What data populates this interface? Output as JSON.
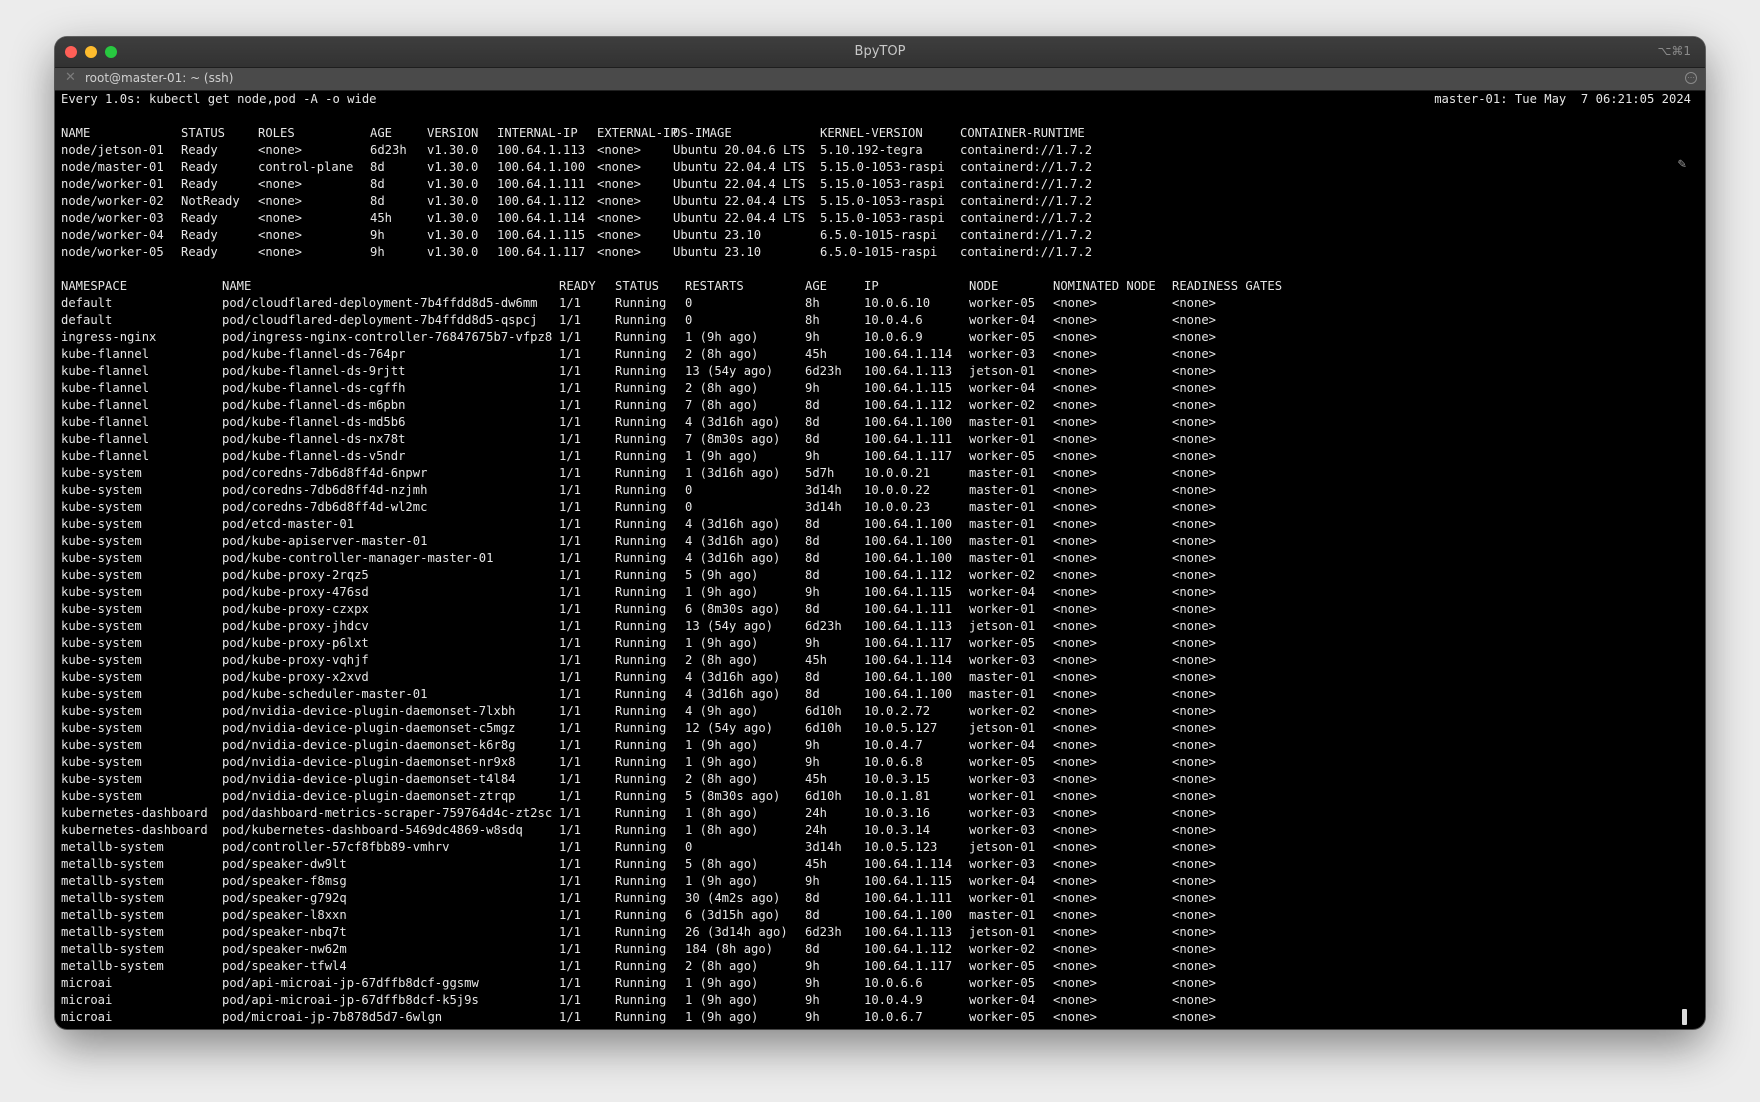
{
  "window": {
    "title": "BpyTOP",
    "shortcut": "⌥⌘1",
    "tab_title": "root@master-01: ~ (ssh)",
    "tab_close_glyph": "✕",
    "tab_menu_glyph": "⋯"
  },
  "watch": {
    "header": "Every 1.0s: kubectl get node,pod -A -o wide",
    "host_time": "master-01: Tue May  7 06:21:05 2024"
  },
  "nodes": {
    "columns": [
      "NAME",
      "STATUS",
      "ROLES",
      "AGE",
      "VERSION",
      "INTERNAL-IP",
      "EXTERNAL-IP",
      "OS-IMAGE",
      "KERNEL-VERSION",
      "CONTAINER-RUNTIME"
    ],
    "rows": [
      [
        "node/jetson-01",
        "Ready",
        "<none>",
        "6d23h",
        "v1.30.0",
        "100.64.1.113",
        "<none>",
        "Ubuntu 20.04.6 LTS",
        "5.10.192-tegra",
        "containerd://1.7.2"
      ],
      [
        "node/master-01",
        "Ready",
        "control-plane",
        "8d",
        "v1.30.0",
        "100.64.1.100",
        "<none>",
        "Ubuntu 22.04.4 LTS",
        "5.15.0-1053-raspi",
        "containerd://1.7.2"
      ],
      [
        "node/worker-01",
        "Ready",
        "<none>",
        "8d",
        "v1.30.0",
        "100.64.1.111",
        "<none>",
        "Ubuntu 22.04.4 LTS",
        "5.15.0-1053-raspi",
        "containerd://1.7.2"
      ],
      [
        "node/worker-02",
        "NotReady",
        "<none>",
        "8d",
        "v1.30.0",
        "100.64.1.112",
        "<none>",
        "Ubuntu 22.04.4 LTS",
        "5.15.0-1053-raspi",
        "containerd://1.7.2"
      ],
      [
        "node/worker-03",
        "Ready",
        "<none>",
        "45h",
        "v1.30.0",
        "100.64.1.114",
        "<none>",
        "Ubuntu 22.04.4 LTS",
        "5.15.0-1053-raspi",
        "containerd://1.7.2"
      ],
      [
        "node/worker-04",
        "Ready",
        "<none>",
        "9h",
        "v1.30.0",
        "100.64.1.115",
        "<none>",
        "Ubuntu 23.10",
        "6.5.0-1015-raspi",
        "containerd://1.7.2"
      ],
      [
        "node/worker-05",
        "Ready",
        "<none>",
        "9h",
        "v1.30.0",
        "100.64.1.117",
        "<none>",
        "Ubuntu 23.10",
        "6.5.0-1015-raspi",
        "containerd://1.7.2"
      ]
    ]
  },
  "pods": {
    "columns": [
      "NAMESPACE",
      "NAME",
      "READY",
      "STATUS",
      "RESTARTS",
      "AGE",
      "IP",
      "NODE",
      "NOMINATED NODE",
      "READINESS GATES"
    ],
    "rows": [
      [
        "default",
        "pod/cloudflared-deployment-7b4ffdd8d5-dw6mm",
        "1/1",
        "Running",
        "0",
        "8h",
        "10.0.6.10",
        "worker-05",
        "<none>",
        "<none>"
      ],
      [
        "default",
        "pod/cloudflared-deployment-7b4ffdd8d5-qspcj",
        "1/1",
        "Running",
        "0",
        "8h",
        "10.0.4.6",
        "worker-04",
        "<none>",
        "<none>"
      ],
      [
        "ingress-nginx",
        "pod/ingress-nginx-controller-76847675b7-vfpz8",
        "1/1",
        "Running",
        "1 (9h ago)",
        "9h",
        "10.0.6.9",
        "worker-05",
        "<none>",
        "<none>"
      ],
      [
        "kube-flannel",
        "pod/kube-flannel-ds-764pr",
        "1/1",
        "Running",
        "2 (8h ago)",
        "45h",
        "100.64.1.114",
        "worker-03",
        "<none>",
        "<none>"
      ],
      [
        "kube-flannel",
        "pod/kube-flannel-ds-9rjtt",
        "1/1",
        "Running",
        "13 (54y ago)",
        "6d23h",
        "100.64.1.113",
        "jetson-01",
        "<none>",
        "<none>"
      ],
      [
        "kube-flannel",
        "pod/kube-flannel-ds-cgffh",
        "1/1",
        "Running",
        "2 (8h ago)",
        "9h",
        "100.64.1.115",
        "worker-04",
        "<none>",
        "<none>"
      ],
      [
        "kube-flannel",
        "pod/kube-flannel-ds-m6pbn",
        "1/1",
        "Running",
        "7 (8h ago)",
        "8d",
        "100.64.1.112",
        "worker-02",
        "<none>",
        "<none>"
      ],
      [
        "kube-flannel",
        "pod/kube-flannel-ds-md5b6",
        "1/1",
        "Running",
        "4 (3d16h ago)",
        "8d",
        "100.64.1.100",
        "master-01",
        "<none>",
        "<none>"
      ],
      [
        "kube-flannel",
        "pod/kube-flannel-ds-nx78t",
        "1/1",
        "Running",
        "7 (8m30s ago)",
        "8d",
        "100.64.1.111",
        "worker-01",
        "<none>",
        "<none>"
      ],
      [
        "kube-flannel",
        "pod/kube-flannel-ds-v5ndr",
        "1/1",
        "Running",
        "1 (9h ago)",
        "9h",
        "100.64.1.117",
        "worker-05",
        "<none>",
        "<none>"
      ],
      [
        "kube-system",
        "pod/coredns-7db6d8ff4d-6npwr",
        "1/1",
        "Running",
        "1 (3d16h ago)",
        "5d7h",
        "10.0.0.21",
        "master-01",
        "<none>",
        "<none>"
      ],
      [
        "kube-system",
        "pod/coredns-7db6d8ff4d-nzjmh",
        "1/1",
        "Running",
        "0",
        "3d14h",
        "10.0.0.22",
        "master-01",
        "<none>",
        "<none>"
      ],
      [
        "kube-system",
        "pod/coredns-7db6d8ff4d-wl2mc",
        "1/1",
        "Running",
        "0",
        "3d14h",
        "10.0.0.23",
        "master-01",
        "<none>",
        "<none>"
      ],
      [
        "kube-system",
        "pod/etcd-master-01",
        "1/1",
        "Running",
        "4 (3d16h ago)",
        "8d",
        "100.64.1.100",
        "master-01",
        "<none>",
        "<none>"
      ],
      [
        "kube-system",
        "pod/kube-apiserver-master-01",
        "1/1",
        "Running",
        "4 (3d16h ago)",
        "8d",
        "100.64.1.100",
        "master-01",
        "<none>",
        "<none>"
      ],
      [
        "kube-system",
        "pod/kube-controller-manager-master-01",
        "1/1",
        "Running",
        "4 (3d16h ago)",
        "8d",
        "100.64.1.100",
        "master-01",
        "<none>",
        "<none>"
      ],
      [
        "kube-system",
        "pod/kube-proxy-2rqz5",
        "1/1",
        "Running",
        "5 (9h ago)",
        "8d",
        "100.64.1.112",
        "worker-02",
        "<none>",
        "<none>"
      ],
      [
        "kube-system",
        "pod/kube-proxy-476sd",
        "1/1",
        "Running",
        "1 (9h ago)",
        "9h",
        "100.64.1.115",
        "worker-04",
        "<none>",
        "<none>"
      ],
      [
        "kube-system",
        "pod/kube-proxy-czxpx",
        "1/1",
        "Running",
        "6 (8m30s ago)",
        "8d",
        "100.64.1.111",
        "worker-01",
        "<none>",
        "<none>"
      ],
      [
        "kube-system",
        "pod/kube-proxy-jhdcv",
        "1/1",
        "Running",
        "13 (54y ago)",
        "6d23h",
        "100.64.1.113",
        "jetson-01",
        "<none>",
        "<none>"
      ],
      [
        "kube-system",
        "pod/kube-proxy-p6lxt",
        "1/1",
        "Running",
        "1 (9h ago)",
        "9h",
        "100.64.1.117",
        "worker-05",
        "<none>",
        "<none>"
      ],
      [
        "kube-system",
        "pod/kube-proxy-vqhjf",
        "1/1",
        "Running",
        "2 (8h ago)",
        "45h",
        "100.64.1.114",
        "worker-03",
        "<none>",
        "<none>"
      ],
      [
        "kube-system",
        "pod/kube-proxy-x2xvd",
        "1/1",
        "Running",
        "4 (3d16h ago)",
        "8d",
        "100.64.1.100",
        "master-01",
        "<none>",
        "<none>"
      ],
      [
        "kube-system",
        "pod/kube-scheduler-master-01",
        "1/1",
        "Running",
        "4 (3d16h ago)",
        "8d",
        "100.64.1.100",
        "master-01",
        "<none>",
        "<none>"
      ],
      [
        "kube-system",
        "pod/nvidia-device-plugin-daemonset-7lxbh",
        "1/1",
        "Running",
        "4 (9h ago)",
        "6d10h",
        "10.0.2.72",
        "worker-02",
        "<none>",
        "<none>"
      ],
      [
        "kube-system",
        "pod/nvidia-device-plugin-daemonset-c5mgz",
        "1/1",
        "Running",
        "12 (54y ago)",
        "6d10h",
        "10.0.5.127",
        "jetson-01",
        "<none>",
        "<none>"
      ],
      [
        "kube-system",
        "pod/nvidia-device-plugin-daemonset-k6r8g",
        "1/1",
        "Running",
        "1 (9h ago)",
        "9h",
        "10.0.4.7",
        "worker-04",
        "<none>",
        "<none>"
      ],
      [
        "kube-system",
        "pod/nvidia-device-plugin-daemonset-nr9x8",
        "1/1",
        "Running",
        "1 (9h ago)",
        "9h",
        "10.0.6.8",
        "worker-05",
        "<none>",
        "<none>"
      ],
      [
        "kube-system",
        "pod/nvidia-device-plugin-daemonset-t4l84",
        "1/1",
        "Running",
        "2 (8h ago)",
        "45h",
        "10.0.3.15",
        "worker-03",
        "<none>",
        "<none>"
      ],
      [
        "kube-system",
        "pod/nvidia-device-plugin-daemonset-ztrqp",
        "1/1",
        "Running",
        "5 (8m30s ago)",
        "6d10h",
        "10.0.1.81",
        "worker-01",
        "<none>",
        "<none>"
      ],
      [
        "kubernetes-dashboard",
        "pod/dashboard-metrics-scraper-759764d4c-zt2sc",
        "1/1",
        "Running",
        "1 (8h ago)",
        "24h",
        "10.0.3.16",
        "worker-03",
        "<none>",
        "<none>"
      ],
      [
        "kubernetes-dashboard",
        "pod/kubernetes-dashboard-5469dc4869-w8sdq",
        "1/1",
        "Running",
        "1 (8h ago)",
        "24h",
        "10.0.3.14",
        "worker-03",
        "<none>",
        "<none>"
      ],
      [
        "metallb-system",
        "pod/controller-57cf8fbb89-vmhrv",
        "1/1",
        "Running",
        "0",
        "3d14h",
        "10.0.5.123",
        "jetson-01",
        "<none>",
        "<none>"
      ],
      [
        "metallb-system",
        "pod/speaker-dw9lt",
        "1/1",
        "Running",
        "5 (8h ago)",
        "45h",
        "100.64.1.114",
        "worker-03",
        "<none>",
        "<none>"
      ],
      [
        "metallb-system",
        "pod/speaker-f8msg",
        "1/1",
        "Running",
        "1 (9h ago)",
        "9h",
        "100.64.1.115",
        "worker-04",
        "<none>",
        "<none>"
      ],
      [
        "metallb-system",
        "pod/speaker-g792q",
        "1/1",
        "Running",
        "30 (4m2s ago)",
        "8d",
        "100.64.1.111",
        "worker-01",
        "<none>",
        "<none>"
      ],
      [
        "metallb-system",
        "pod/speaker-l8xxn",
        "1/1",
        "Running",
        "6 (3d15h ago)",
        "8d",
        "100.64.1.100",
        "master-01",
        "<none>",
        "<none>"
      ],
      [
        "metallb-system",
        "pod/speaker-nbq7t",
        "1/1",
        "Running",
        "26 (3d14h ago)",
        "6d23h",
        "100.64.1.113",
        "jetson-01",
        "<none>",
        "<none>"
      ],
      [
        "metallb-system",
        "pod/speaker-nw62m",
        "1/1",
        "Running",
        "184 (8h ago)",
        "8d",
        "100.64.1.112",
        "worker-02",
        "<none>",
        "<none>"
      ],
      [
        "metallb-system",
        "pod/speaker-tfwl4",
        "1/1",
        "Running",
        "2 (8h ago)",
        "9h",
        "100.64.1.117",
        "worker-05",
        "<none>",
        "<none>"
      ],
      [
        "microai",
        "pod/api-microai-jp-67dffb8dcf-ggsmw",
        "1/1",
        "Running",
        "1 (9h ago)",
        "9h",
        "10.0.6.6",
        "worker-05",
        "<none>",
        "<none>"
      ],
      [
        "microai",
        "pod/api-microai-jp-67dffb8dcf-k5j9s",
        "1/1",
        "Running",
        "1 (9h ago)",
        "9h",
        "10.0.4.9",
        "worker-04",
        "<none>",
        "<none>"
      ],
      [
        "microai",
        "pod/microai-jp-7b878d5d7-6wlgn",
        "1/1",
        "Running",
        "1 (9h ago)",
        "9h",
        "10.0.6.7",
        "worker-05",
        "<none>",
        "<none>"
      ]
    ]
  }
}
